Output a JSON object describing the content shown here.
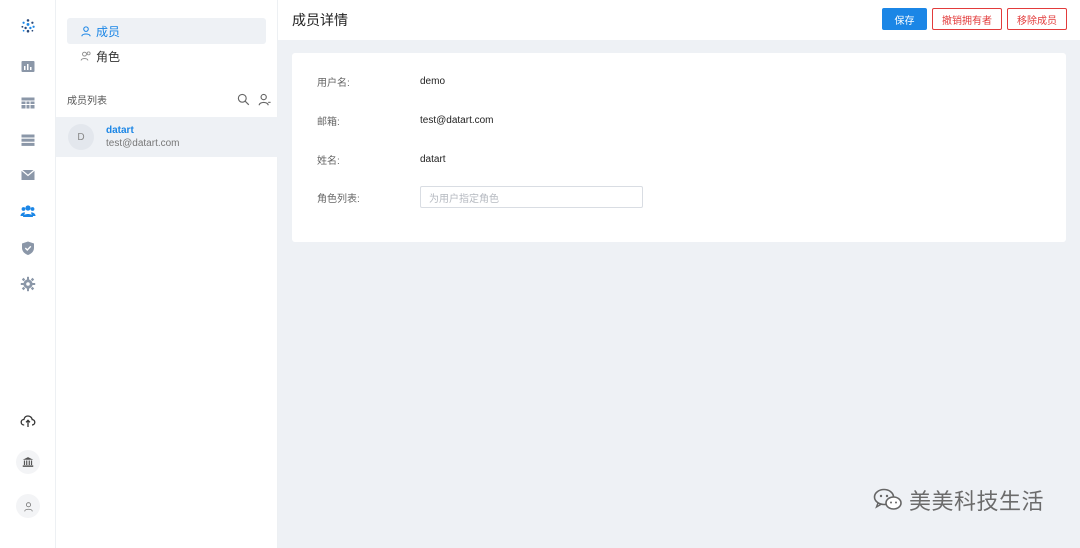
{
  "rail": {
    "items": [
      {
        "name": "dashboard-icon"
      },
      {
        "name": "table-icon"
      },
      {
        "name": "list-icon"
      },
      {
        "name": "mail-icon"
      },
      {
        "name": "users-icon"
      },
      {
        "name": "shield-icon"
      },
      {
        "name": "gear-icon"
      }
    ],
    "bottom": [
      {
        "name": "cloud-upload-icon"
      },
      {
        "name": "bank-icon"
      },
      {
        "name": "user-icon"
      }
    ]
  },
  "panel": {
    "tabs": [
      {
        "label": "成员"
      },
      {
        "label": "角色"
      }
    ],
    "list_title": "成员列表",
    "members": [
      {
        "avatar": "D",
        "name": "datart",
        "email": "test@datart.com"
      }
    ]
  },
  "header": {
    "title": "成员详情",
    "save_label": "保存",
    "revoke_owner_label": "撤销拥有者",
    "remove_member_label": "移除成员"
  },
  "detail": {
    "username_label": "用户名:",
    "username_value": "demo",
    "email_label": "邮箱:",
    "email_value": "test@datart.com",
    "name_label": "姓名:",
    "name_value": "datart",
    "roles_label": "角色列表:",
    "roles_placeholder": "为用户指定角色"
  },
  "watermark": {
    "text": "美美科技生活"
  },
  "colors": {
    "accent": "#1b86e6",
    "danger": "#e23b3b",
    "background": "#eef1f5",
    "active_rail": "#1b86e6"
  }
}
